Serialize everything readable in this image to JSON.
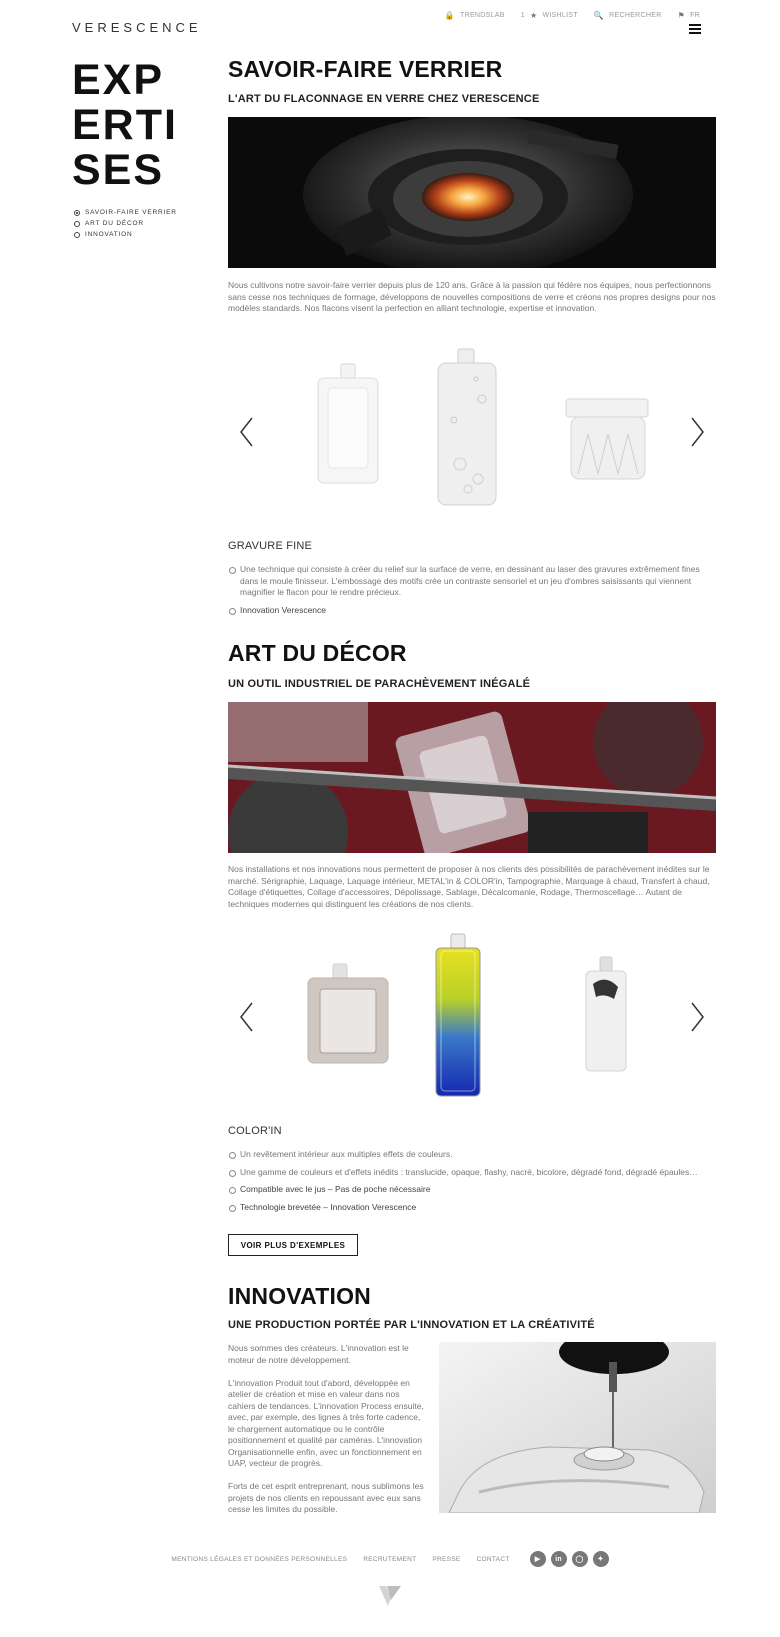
{
  "header": {
    "logo": "VERESCENCE",
    "nav": {
      "trendslab": "TRENDSLAB",
      "wishlist_count": "1",
      "wishlist": "WISHLIST",
      "search": "RECHERCHER",
      "lang": "FR"
    }
  },
  "sidebar": {
    "title_lines": [
      "EXP",
      "ERTI",
      "SES"
    ],
    "items": [
      {
        "label": "SAVOIR-FAIRE VERRIER",
        "active": true
      },
      {
        "label": "ART DU DÉCOR",
        "active": false
      },
      {
        "label": "INNOVATION",
        "active": false
      }
    ]
  },
  "section1": {
    "title": "SAVOIR-FAIRE VERRIER",
    "subtitle": "L'ART DU FLACONNAGE EN VERRE CHEZ VERESCENCE",
    "text": "Nous cultivons notre savoir-faire verrier depuis plus de 120 ans. Grâce à la passion qui fédère nos équipes, nous perfectionnons sans cesse nos techniques de formage, développons de nouvelles compositions de verre et créons nos propres designs pour nos modèles standards. Nos flacons visent la perfection en alliant technologie, expertise et innovation.",
    "feature_title": "GRAVURE FINE",
    "bullets": [
      "Une technique qui consiste à créer du relief sur la surface de verre, en dessinant au laser des gravures extrêmement fines dans le moule finisseur. L'embossage des motifs crée un contraste sensoriel et un jeu d'ombres saisissants qui viennent magnifier le flacon pour le rendre précieux.",
      "Innovation Verescence"
    ]
  },
  "section2": {
    "title": "ART DU DÉCOR",
    "subtitle": "UN OUTIL INDUSTRIEL DE PARACHÈVEMENT INÉGALÉ",
    "text": "Nos installations et nos innovations nous permettent de proposer à nos clients des possibilités de parachèvement inédites sur le marché. Sérigraphie, Laquage, Laquage intérieur, METAL'in & COLOR'in, Tampographie, Marquage à chaud, Transfert à chaud, Collage d'étiquettes, Collage d'accessoires, Dépolissage, Sablage, Décalcomanie, Rodage, Thermoscellage… Autant de techniques modernes qui distinguent les créations de nos clients.",
    "feature_title": "COLOR'IN",
    "bullets": [
      "Un revêtement intérieur aux multiples effets de couleurs.",
      "Une gamme de couleurs et d'effets inédits : translucide, opaque, flashy, nacré, bicolore, dégradé fond, dégradé épaules…",
      "Compatible avec le jus – Pas de poche nécessaire",
      "Technologie brevetée – Innovation Verescence"
    ],
    "button": "VOIR PLUS D'EXEMPLES"
  },
  "section3": {
    "title": "INNOVATION",
    "subtitle": "UNE PRODUCTION PORTÉE PAR L'INNOVATION ET LA CRÉATIVITÉ",
    "paragraphs": [
      "Nous sommes des créateurs. L'innovation est le moteur de notre développement.",
      "L'innovation Produit tout d'abord, développée en atelier de création et mise en valeur dans nos cahiers de tendances. L'innovation Process ensuite, avec, par exemple, des lignes à très forte cadence, le chargement automatique ou le contrôle positionnement et qualité par caméras. L'innovation Organisationnelle enfin, avec un fonctionnement en UAP, vecteur de progrès.",
      "Forts de cet esprit entreprenant, nous sublimons les projets de nos clients en repoussant avec eux sans cesse les limites du possible."
    ]
  },
  "footer": {
    "links": [
      "MENTIONS LÉGALES ET DONNÉES PERSONNELLES",
      "RECRUTEMENT",
      "PRESSE",
      "CONTACT"
    ],
    "socials": [
      "youtube-icon",
      "linkedin-icon",
      "instagram-icon",
      "twitter-icon"
    ]
  }
}
